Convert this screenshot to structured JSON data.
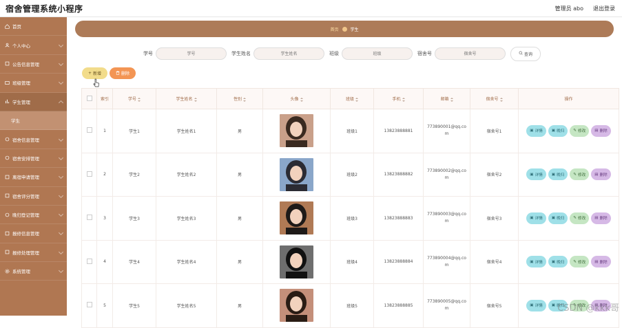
{
  "app": {
    "title": "宿舍管理系统小程序"
  },
  "topbar": {
    "user": "管理员 abo",
    "logout": "退出登录"
  },
  "sidebar": {
    "items": [
      {
        "label": "首页",
        "icon": "home-icon"
      },
      {
        "label": "个人中心",
        "icon": "user-icon"
      },
      {
        "label": "公告信息管理",
        "icon": "notice-icon"
      },
      {
        "label": "班级管理",
        "icon": "class-icon"
      },
      {
        "label": "学生管理",
        "icon": "student-icon"
      },
      {
        "label": "学生",
        "icon": ""
      },
      {
        "label": "宿舍信息管理",
        "icon": "dorm-icon"
      },
      {
        "label": "宿舍安排管理",
        "icon": "arrange-icon"
      },
      {
        "label": "离宿申请管理",
        "icon": "leave-icon"
      },
      {
        "label": "宿舍评分管理",
        "icon": "score-icon"
      },
      {
        "label": "晚归登记管理",
        "icon": "late-icon"
      },
      {
        "label": "报修信息管理",
        "icon": "repair-icon"
      },
      {
        "label": "报修处理管理",
        "icon": "process-icon"
      },
      {
        "label": "系统管理",
        "icon": "system-icon"
      }
    ]
  },
  "breadcrumb": {
    "home": "首页",
    "current": "学生"
  },
  "search": {
    "fields": [
      {
        "label": "学号",
        "placeholder": "学号"
      },
      {
        "label": "学生姓名",
        "placeholder": "学生姓名"
      },
      {
        "label": "班级",
        "placeholder": "班级"
      },
      {
        "label": "宿舍号",
        "placeholder": "宿舍号"
      }
    ],
    "button": "查询"
  },
  "actions": {
    "add": "新增",
    "delete": "删除"
  },
  "table": {
    "headers": [
      "索引",
      "学号",
      "学生姓名",
      "性别",
      "头像",
      "班级",
      "手机",
      "邮箱",
      "宿舍号",
      "操作"
    ],
    "ops": {
      "detail": "详情",
      "back": "晚归",
      "edit": "修改",
      "remove": "删除"
    },
    "rows": [
      {
        "index": "1",
        "sid": "学生1",
        "name": "学生姓名1",
        "gender": "男",
        "class": "班级1",
        "phone": "13823888881",
        "email": "773890001@qq.com",
        "dorm": "宿舍号1"
      },
      {
        "index": "2",
        "sid": "学生2",
        "name": "学生姓名2",
        "gender": "男",
        "class": "班级2",
        "phone": "13823888882",
        "email": "773890002@qq.com",
        "dorm": "宿舍号2"
      },
      {
        "index": "3",
        "sid": "学生3",
        "name": "学生姓名3",
        "gender": "男",
        "class": "班级3",
        "phone": "13823888883",
        "email": "773890003@qq.com",
        "dorm": "宿舍号3"
      },
      {
        "index": "4",
        "sid": "学生4",
        "name": "学生姓名4",
        "gender": "男",
        "class": "班级4",
        "phone": "13823888884",
        "email": "773890004@qq.com",
        "dorm": "宿舍号4"
      },
      {
        "index": "5",
        "sid": "学生5",
        "name": "学生姓名5",
        "gender": "男",
        "class": "班级5",
        "phone": "13823888885",
        "email": "773890005@qq.com",
        "dorm": "宿舍号5"
      }
    ]
  },
  "watermark": "CSDN @kkk哥",
  "colors": {
    "sidebar": "#b07752",
    "breadcrumb": "#ad7b58",
    "add": "#f2dc8b",
    "delete": "#f39554"
  }
}
